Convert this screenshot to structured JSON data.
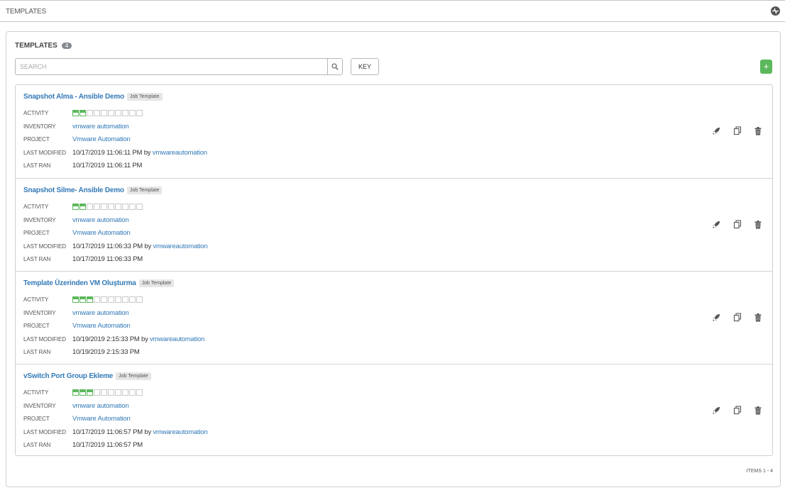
{
  "topbar": {
    "breadcrumb": "TEMPLATES",
    "activity_icon": "activity-stream-icon"
  },
  "panel": {
    "title": "TEMPLATES",
    "count": "4",
    "search_placeholder": "SEARCH",
    "key_label": "KEY",
    "add_label": "+",
    "items_label": "ITEMS 1 - 4"
  },
  "labels": {
    "activity": "ACTIVITY",
    "inventory": "INVENTORY",
    "project": "PROJECT",
    "last_modified": "LAST MODIFIED",
    "last_ran": "LAST RAN",
    "by": "by"
  },
  "templates": [
    {
      "name": "Snapshot Alma - Ansible Demo",
      "type": "Job Template",
      "activity": [
        "success",
        "success",
        "none",
        "none",
        "none",
        "none",
        "none",
        "none",
        "none",
        "none"
      ],
      "inventory": "vmware automation",
      "project": "Vmware Automation",
      "last_modified": "10/17/2019 11:06:11 PM",
      "modified_by": "vmwareautomation",
      "last_ran": "10/17/2019 11:06:11 PM"
    },
    {
      "name": "Snapshot Silme- Ansible Demo",
      "type": "Job Template",
      "activity": [
        "success",
        "success",
        "none",
        "none",
        "none",
        "none",
        "none",
        "none",
        "none",
        "none"
      ],
      "inventory": "vmware automation",
      "project": "Vmware Automation",
      "last_modified": "10/17/2019 11:06:33 PM",
      "modified_by": "vmwareautomation",
      "last_ran": "10/17/2019 11:06:33 PM"
    },
    {
      "name": "Template Üzerinden VM Oluşturma",
      "type": "Job Template",
      "activity": [
        "success",
        "success",
        "success",
        "none",
        "none",
        "none",
        "none",
        "none",
        "none",
        "none"
      ],
      "inventory": "vmware automation",
      "project": "Vmware Automation",
      "last_modified": "10/19/2019 2:15:33 PM",
      "modified_by": "vmwareautomation",
      "last_ran": "10/19/2019 2:15:33 PM"
    },
    {
      "name": "vSwitch Port Group Ekleme",
      "type": "Job Template",
      "activity": [
        "success",
        "success",
        "success",
        "none",
        "none",
        "none",
        "none",
        "none",
        "none",
        "none"
      ],
      "inventory": "vmware automation",
      "project": "Vmware Automation",
      "last_modified": "10/17/2019 11:06:57 PM",
      "modified_by": "vmwareautomation",
      "last_ran": "10/17/2019 11:06:57 PM"
    }
  ],
  "row_actions": [
    "rocket-launch-icon",
    "copy-icon",
    "trash-icon"
  ]
}
